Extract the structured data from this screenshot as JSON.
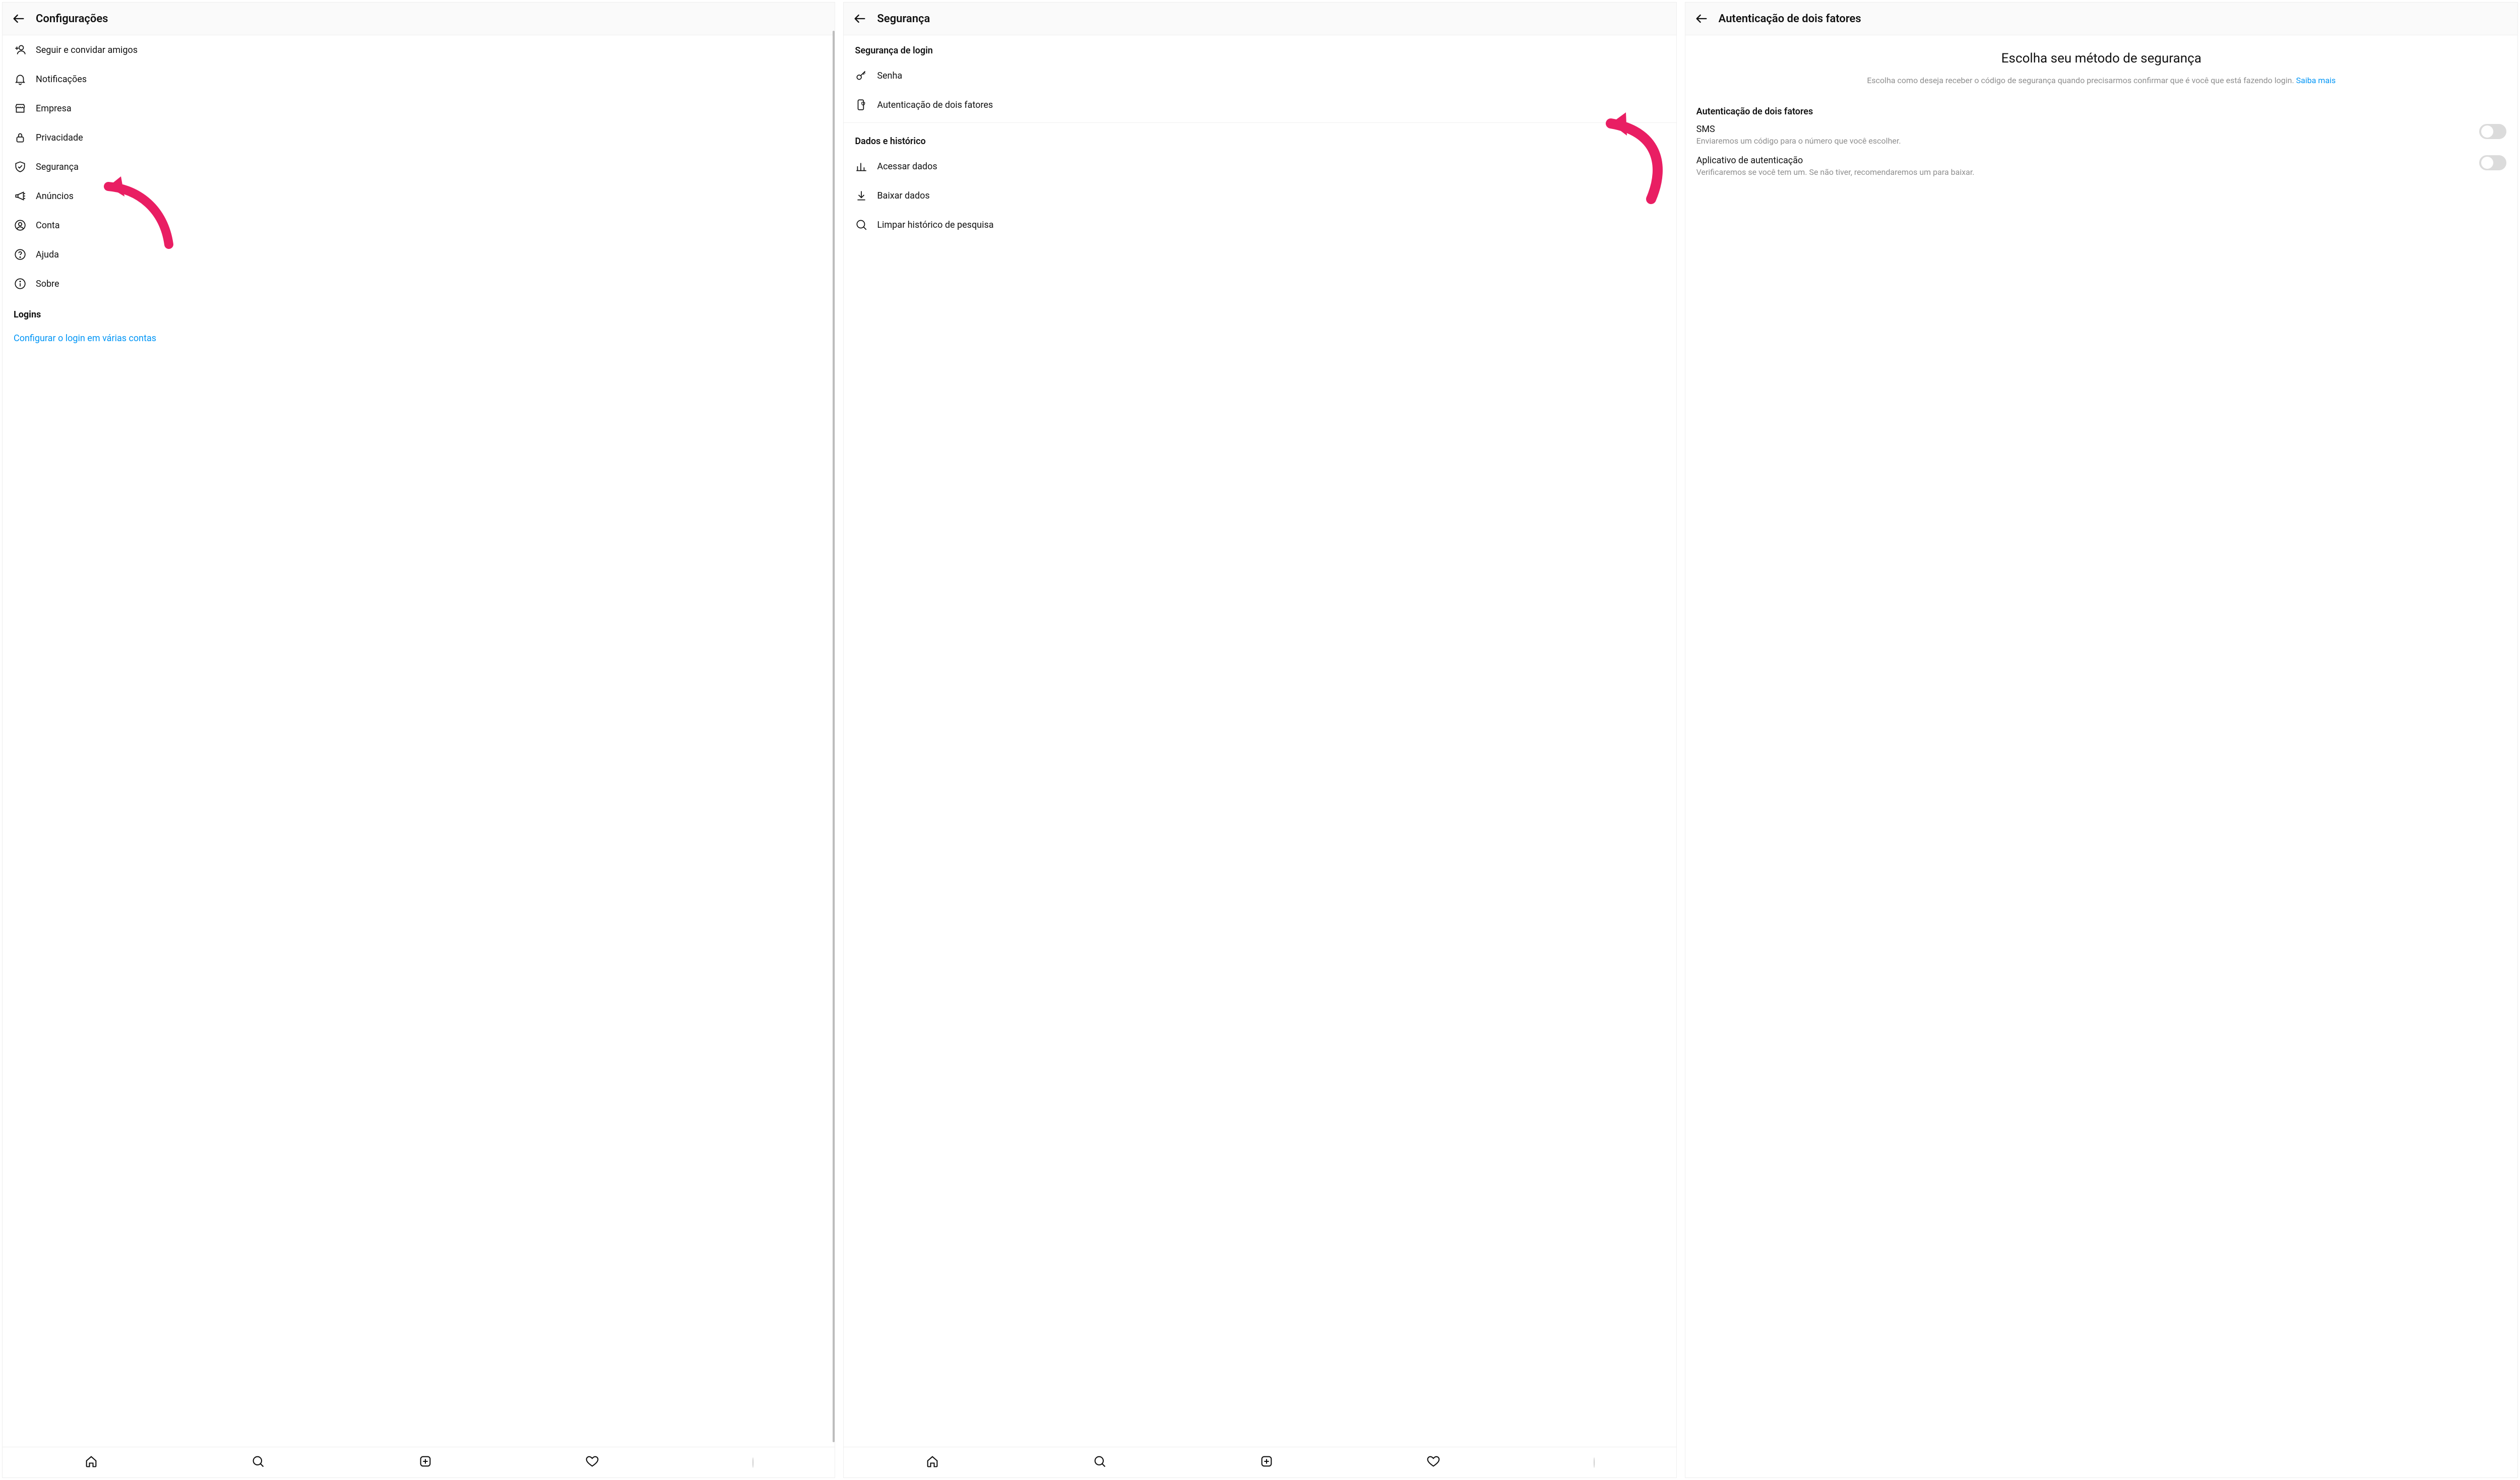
{
  "colors": {
    "accent_pink": "#e91e63",
    "link_blue": "#0095f6",
    "muted": "#8e8e8e"
  },
  "screen1": {
    "title": "Configurações",
    "items": [
      {
        "icon": "add-person",
        "label": "Seguir e convidar amigos"
      },
      {
        "icon": "bell",
        "label": "Notificações"
      },
      {
        "icon": "storefront",
        "label": "Empresa"
      },
      {
        "icon": "lock",
        "label": "Privacidade"
      },
      {
        "icon": "shield",
        "label": "Segurança"
      },
      {
        "icon": "megaphone",
        "label": "Anúncios"
      },
      {
        "icon": "user-circle",
        "label": "Conta"
      },
      {
        "icon": "help",
        "label": "Ajuda"
      },
      {
        "icon": "info",
        "label": "Sobre"
      }
    ],
    "logins_heading": "Logins",
    "multi_login_link": "Configurar o login em várias contas"
  },
  "screen2": {
    "title": "Segurança",
    "section1_heading": "Segurança de login",
    "section1_items": [
      {
        "icon": "key",
        "label": "Senha"
      },
      {
        "icon": "phone-shield",
        "label": "Autenticação de dois fatores"
      }
    ],
    "section2_heading": "Dados e histórico",
    "section2_items": [
      {
        "icon": "bar-chart",
        "label": "Acessar dados"
      },
      {
        "icon": "download",
        "label": "Baixar dados"
      },
      {
        "icon": "search",
        "label": "Limpar histórico de pesquisa"
      }
    ]
  },
  "screen3": {
    "title": "Autenticação de dois fatores",
    "headline": "Escolha seu método de segurança",
    "description": "Escolha como deseja receber o código de segurança quando precisarmos confirmar que é você que está fazendo login.",
    "learn_more": "Saiba mais",
    "subheading": "Autenticação de dois fatores",
    "options": [
      {
        "title": "SMS",
        "desc": "Enviaremos um código para o número que você escolher.",
        "on": false
      },
      {
        "title": "Aplicativo de autenticação",
        "desc": "Verificaremos se você tem um. Se não tiver, recomendaremos um para baixar.",
        "on": false
      }
    ]
  }
}
